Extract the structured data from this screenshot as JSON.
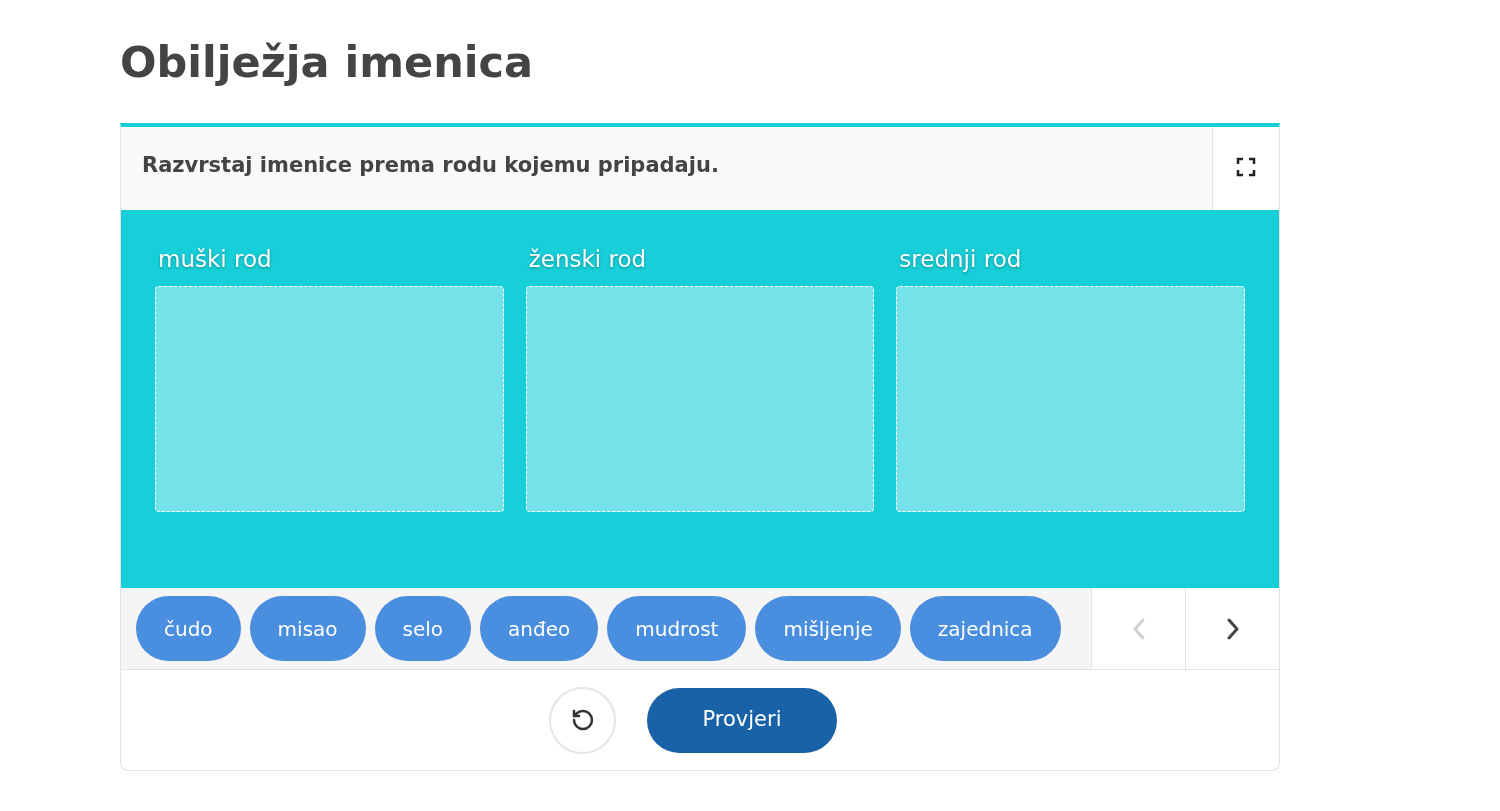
{
  "page_title": "Obilježja imenica",
  "task": {
    "instruction": "Razvrstaj imenice prema rodu kojemu pripadaju."
  },
  "categories": [
    {
      "label": "muški rod"
    },
    {
      "label": "ženski rod"
    },
    {
      "label": "srednji rod"
    }
  ],
  "chips": [
    "čudo",
    "misao",
    "selo",
    "anđeo",
    "mudrost",
    "mišljenje",
    "zajednica"
  ],
  "nav": [
    {
      "kind": "prev",
      "disabled": true
    },
    {
      "kind": "next",
      "disabled": false
    }
  ],
  "check_button": "Provjeri"
}
